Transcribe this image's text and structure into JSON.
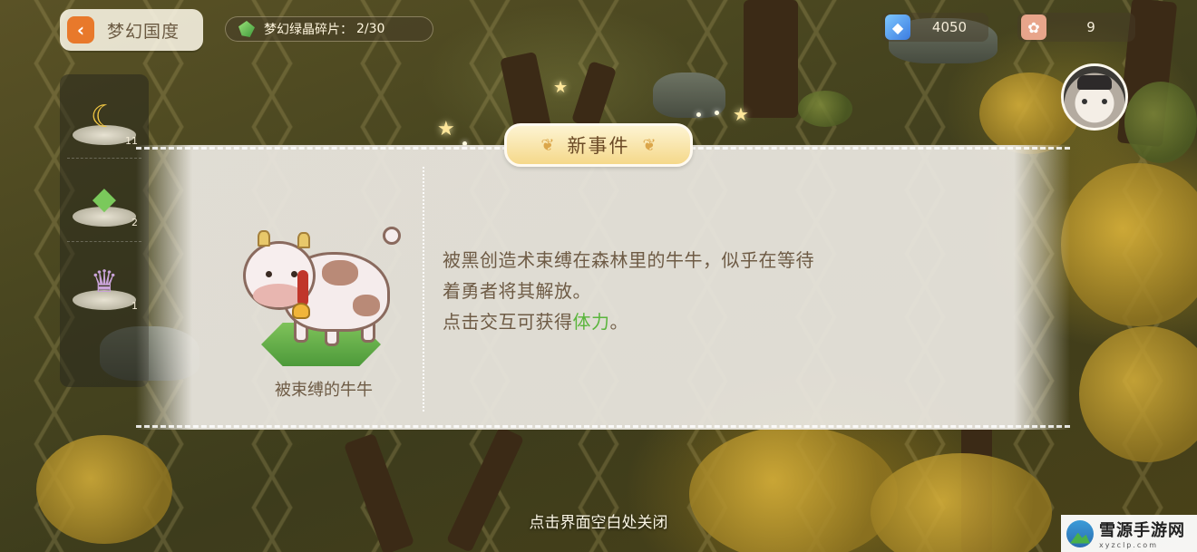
{
  "header": {
    "back_label": "梦幻国度",
    "shards": {
      "label": "梦幻绿晶碎片：",
      "value": "2/30"
    },
    "resources": [
      {
        "icon": "gem-icon",
        "value": "4050"
      },
      {
        "icon": "paw-icon",
        "value": "9"
      }
    ]
  },
  "side_panel": {
    "items": [
      {
        "name": "moon-item",
        "icon": "moon-icon",
        "count": "11"
      },
      {
        "name": "crystal-item",
        "icon": "crystal-icon",
        "count": "2"
      },
      {
        "name": "fountain-item",
        "icon": "fountain-icon",
        "count": "1"
      }
    ]
  },
  "event": {
    "badge_title": "新事件",
    "creature_name": "被束缚的牛牛",
    "description_lines": [
      "被黑创造术束缚在森林里的牛牛，似乎在等待",
      "着勇者将其解放。"
    ],
    "reward_prefix": "点击交互可获得",
    "reward_highlight": "体力",
    "reward_suffix": "。"
  },
  "close_hint": "点击界面空白处关闭",
  "watermark": {
    "title": "雪源手游网",
    "url": "xyzclp.com"
  },
  "colors": {
    "accent_orange": "#e8792b",
    "highlight_green": "#5ab53c",
    "badge_gold": "#f5d88a",
    "text_brown": "#6e5b45"
  }
}
